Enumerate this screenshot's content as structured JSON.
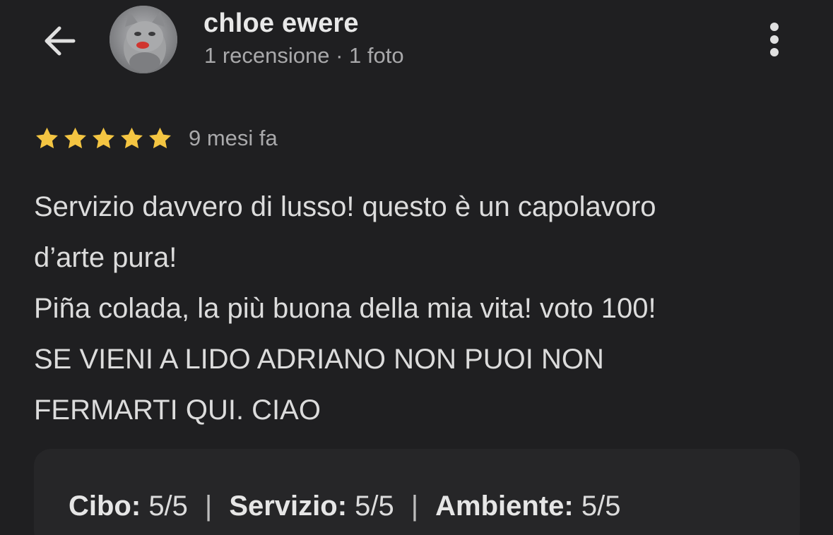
{
  "header": {
    "author_name": "chloe ewere",
    "author_meta": "1 recensione · 1 foto",
    "back_icon": "arrow-left-icon",
    "more_icon": "more-vertical-icon"
  },
  "review": {
    "rating": 5,
    "rating_max": 5,
    "star_color": "#f4c542",
    "date": "9 mesi fa",
    "lines": [
      "Servizio davvero di lusso! questo è un capolavoro",
      "d’arte pura!",
      "Piña colada, la più buona della mia vita! voto 100!",
      "SE VIENI A LIDO ADRIANO NON PUOI NON",
      "FERMARTI QUI. CIAO"
    ]
  },
  "sub_ratings": {
    "items": [
      {
        "label": "Cibo:",
        "value": "5/5"
      },
      {
        "label": "Servizio:",
        "value": "5/5"
      },
      {
        "label": "Ambiente:",
        "value": "5/5"
      }
    ],
    "separator": "|"
  },
  "colors": {
    "background": "#1f1f21",
    "text_primary": "#e3e3e3",
    "text_secondary": "#a9a9ab"
  }
}
